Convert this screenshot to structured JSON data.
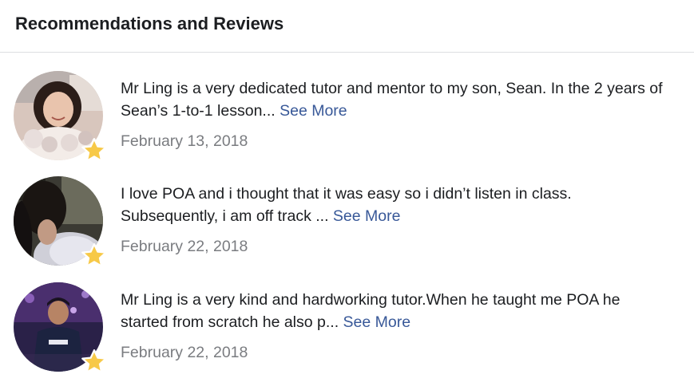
{
  "header": {
    "title": "Recommendations and Reviews"
  },
  "reviews": [
    {
      "text": "Mr Ling is a very dedicated tutor and mentor to my son, Sean. In the 2 years of Sean’s 1-to-1 lesson...",
      "see_more": "See More",
      "date": "February 13, 2018"
    },
    {
      "text": "I love POA and i thought that it was easy so i didn’t listen in class. Subsequently, i am off track ...",
      "see_more": "See More",
      "date": "February 22, 2018"
    },
    {
      "text": "Mr Ling is a very kind and hardworking tutor.When he taught me POA he started from scratch he also p...",
      "see_more": "See More",
      "date": "February 22, 2018"
    }
  ],
  "icons": {
    "rating": "star-icon"
  },
  "colors": {
    "link": "#385898",
    "date": "#7a7c80",
    "star": "#f7c948",
    "divider": "#dddfe2"
  }
}
